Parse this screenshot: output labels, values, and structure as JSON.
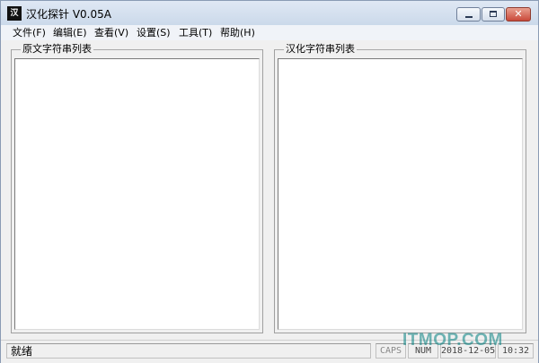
{
  "window": {
    "title": "汉化探针  V0.05A",
    "icon_text": "汉",
    "close_glyph": "✕"
  },
  "menu": [
    {
      "label": "文件(F)"
    },
    {
      "label": "编辑(E)"
    },
    {
      "label": "查看(V)"
    },
    {
      "label": "设置(S)"
    },
    {
      "label": "工具(T)"
    },
    {
      "label": "帮助(H)"
    }
  ],
  "panels": {
    "left_label": "原文字符串列表",
    "right_label": "汉化字符串列表"
  },
  "status": {
    "message": "就绪",
    "caps": "CAPS",
    "num": "NUM",
    "date": "2018-12-05",
    "time": "10:32"
  },
  "watermark": "ITMOP.COM"
}
